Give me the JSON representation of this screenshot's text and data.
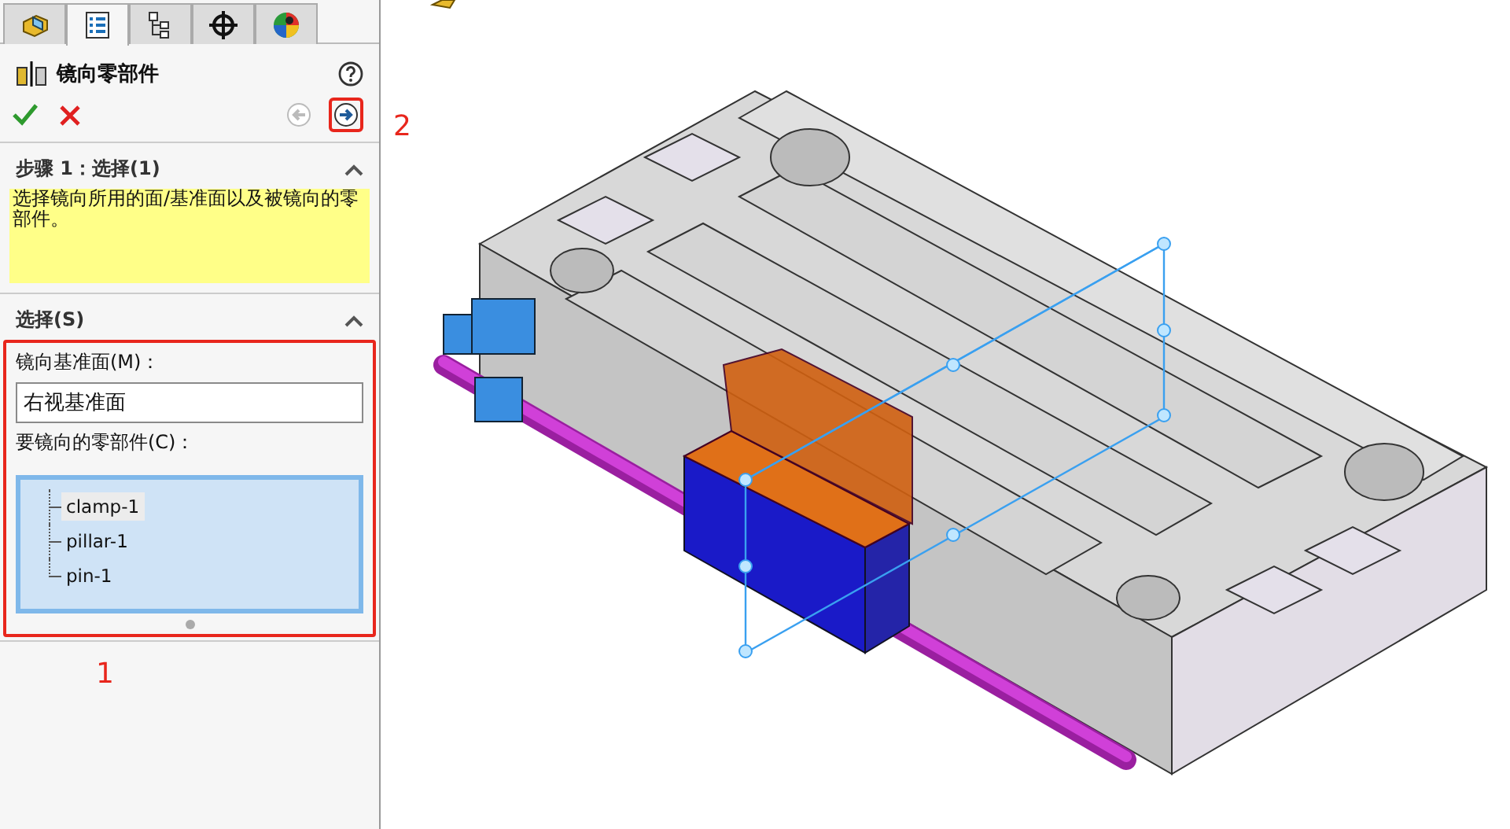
{
  "tabs": [
    {
      "kind": "feature",
      "selected": false
    },
    {
      "kind": "property",
      "selected": true
    },
    {
      "kind": "config",
      "selected": false
    },
    {
      "kind": "dimxpert",
      "selected": false
    },
    {
      "kind": "display",
      "selected": false
    }
  ],
  "property_manager": {
    "title": "镜向零部件",
    "back_disabled": true,
    "next_annotation": "2"
  },
  "sections": [
    {
      "kind": "message",
      "title": "步骤 1：选择(1)",
      "expanded": true,
      "message": "选择镜向所用的面/基准面以及被镜向的零部件。"
    },
    {
      "kind": "selection",
      "title": "选择(S)",
      "expanded": true,
      "annotation": "1",
      "plane_label": "镜向基准面(M)：",
      "plane_value": "右视基准面",
      "components_label": "要镜向的零部件(C)：",
      "components": [
        {
          "label": "clamp-1",
          "selected": true
        },
        {
          "label": "pillar-1",
          "selected": false
        },
        {
          "label": "pin-1",
          "selected": false
        }
      ]
    }
  ]
}
